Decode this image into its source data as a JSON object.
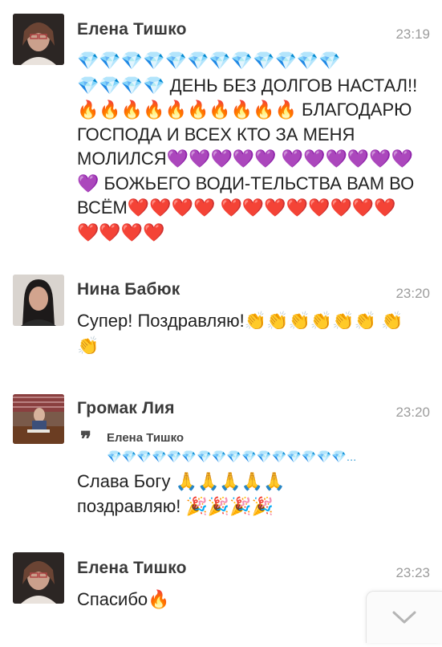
{
  "messages": [
    {
      "author": "Елена Тишко",
      "time": "23:19",
      "text": "💎💎💎💎💎💎💎💎💎💎💎💎\n💎💎💎💎 ДЕНЬ БЕЗ ДОЛГОВ НАСТАЛ!!🔥🔥🔥🔥🔥🔥🔥🔥🔥🔥 БЛАГОДАРЮ ГОСПОДА И ВСЕХ КТО ЗА МЕНЯ МОЛИЛСЯ💜💜💜💜💜 💜💜💜💜💜💜💜 БОЖЬЕГО ВОДИ-ТЕЛЬСТВА ВАМ ВО ВСЁМ❤️❤️❤️❤️ ❤️❤️❤️❤️❤️❤️❤️❤️❤️❤️❤️❤️"
    },
    {
      "author": "Нина Бабюк",
      "time": "23:20",
      "text": "Супер! Поздравляю!👏👏👏👏👏👏 👏👏"
    },
    {
      "author": "Громак Лия",
      "time": "23:20",
      "quote_author": "Елена Тишко",
      "quote_text": "💎💎💎💎💎💎💎💎💎💎💎💎💎💎💎💎...",
      "text": "Слава Богу 🙏🙏🙏🙏🙏\nпоздравляю! 🎉🎉🎉🎉"
    },
    {
      "author": "Елена Тишко",
      "time": "23:23",
      "text": "Спасибо🔥"
    }
  ],
  "scroll_button_icon": "chevron-down-icon",
  "colors": {
    "author_name": "#3a3a3a",
    "timestamp": "#9c9c9c",
    "quote_accent": "#4aa6d9"
  }
}
